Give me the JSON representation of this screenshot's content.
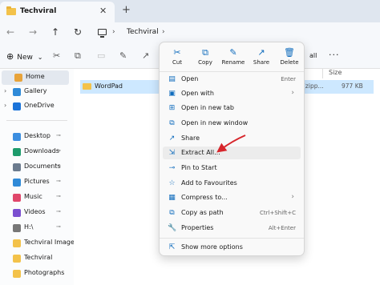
{
  "tab": {
    "title": "Techviral",
    "close": "✕",
    "new": "+"
  },
  "nav": {
    "back": "←",
    "forward": "→",
    "up": "↑",
    "refresh": "↻"
  },
  "address": {
    "chevron1": "›",
    "path": "Techviral",
    "chevron2": "›"
  },
  "toolbar": {
    "new_label": "New",
    "new_chevron": "⌄",
    "all_label": "all",
    "more": "···"
  },
  "sidebar": {
    "items": [
      {
        "label": "Home",
        "icon": "home-icon",
        "color": "#e8a33a"
      },
      {
        "label": "Gallery",
        "icon": "gallery-icon",
        "color": "#2f8ad8"
      },
      {
        "label": "OneDrive",
        "icon": "cloud-icon",
        "color": "#1a73d9"
      },
      {
        "label": "Desktop",
        "icon": "desktop-icon",
        "color": "#3c8ee0"
      },
      {
        "label": "Downloads",
        "icon": "download-icon",
        "color": "#1d9b6c"
      },
      {
        "label": "Documents",
        "icon": "document-icon",
        "color": "#6b7b8e"
      },
      {
        "label": "Pictures",
        "icon": "pictures-icon",
        "color": "#2f8ad8"
      },
      {
        "label": "Music",
        "icon": "music-icon",
        "color": "#e0476b"
      },
      {
        "label": "Videos",
        "icon": "videos-icon",
        "color": "#7b4fd0"
      },
      {
        "label": "H:\\",
        "icon": "drive-icon",
        "color": "#777777"
      },
      {
        "label": "Techviral Image",
        "icon": "folder-icon",
        "color": "#f3c24a"
      },
      {
        "label": "Techviral",
        "icon": "folder-icon",
        "color": "#f3c24a"
      },
      {
        "label": "Photographs",
        "icon": "folder-icon",
        "color": "#f3c24a"
      }
    ],
    "pin": "📌"
  },
  "list": {
    "size_header": "Size",
    "rows": [
      {
        "name": "WordPad",
        "type": "(zipp...",
        "size": "977 KB"
      }
    ]
  },
  "context_menu": {
    "quick_actions": [
      {
        "label": "Cut",
        "icon": "cut-icon",
        "glyph": "✂"
      },
      {
        "label": "Copy",
        "icon": "copy-icon",
        "glyph": "⧉"
      },
      {
        "label": "Rename",
        "icon": "rename-icon",
        "glyph": "✎"
      },
      {
        "label": "Share",
        "icon": "share-icon",
        "glyph": "↗"
      },
      {
        "label": "Delete",
        "icon": "delete-icon",
        "glyph": "🗑"
      }
    ],
    "items": [
      {
        "label": "Open",
        "shortcut": "Enter",
        "submenu": "",
        "icon": "open-icon",
        "glyph": "▤"
      },
      {
        "label": "Open with",
        "shortcut": "",
        "submenu": "›",
        "icon": "open-with-icon",
        "glyph": "▣"
      },
      {
        "label": "Open in new tab",
        "shortcut": "",
        "submenu": "",
        "icon": "new-tab-icon",
        "glyph": "⊞"
      },
      {
        "label": "Open in new window",
        "shortcut": "",
        "submenu": "",
        "icon": "new-window-icon",
        "glyph": "⧉"
      },
      {
        "label": "Share",
        "shortcut": "",
        "submenu": "",
        "icon": "share-icon",
        "glyph": "↗"
      },
      {
        "label": "Extract All...",
        "shortcut": "",
        "submenu": "",
        "icon": "extract-icon",
        "glyph": "⇲"
      },
      {
        "label": "Pin to Start",
        "shortcut": "",
        "submenu": "",
        "icon": "pin-icon",
        "glyph": "⊸"
      },
      {
        "label": "Add to Favourites",
        "shortcut": "",
        "submenu": "",
        "icon": "star-icon",
        "glyph": "☆"
      },
      {
        "label": "Compress to...",
        "shortcut": "",
        "submenu": "›",
        "icon": "compress-icon",
        "glyph": "▦"
      },
      {
        "label": "Copy as path",
        "shortcut": "Ctrl+Shift+C",
        "submenu": "",
        "icon": "copy-path-icon",
        "glyph": "⧉"
      },
      {
        "label": "Properties",
        "shortcut": "Alt+Enter",
        "submenu": "",
        "icon": "properties-icon",
        "glyph": "🔧"
      },
      {
        "label": "Show more options",
        "shortcut": "",
        "submenu": "",
        "icon": "more-options-icon",
        "glyph": "⇱"
      }
    ]
  },
  "colors": {
    "accent": "#0f6cbd",
    "selection": "#cde8ff",
    "annotation_arrow": "#d7262c"
  }
}
